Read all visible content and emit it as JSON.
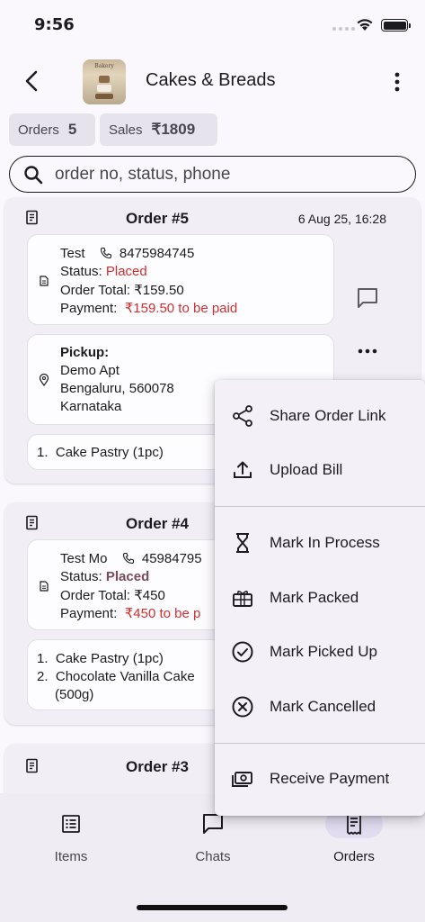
{
  "status_bar": {
    "time": "9:56"
  },
  "appbar": {
    "title": "Cakes & Breads",
    "avatar_text": "Bakery"
  },
  "stats": {
    "orders_label": "Orders",
    "orders_value": "5",
    "sales_label": "Sales",
    "sales_value": "₹1809"
  },
  "search": {
    "placeholder": "order no, status, phone"
  },
  "orders": [
    {
      "title": "Order #5",
      "date": "6 Aug 25, 16:28",
      "customer": "Test",
      "phone": "8475984745",
      "status_label": "Status:",
      "status": "Placed",
      "total_label": "Order Total:",
      "total": "₹159.50",
      "payment_label": "Payment:",
      "payment": "₹159.50 to be paid",
      "pickup_label": "Pickup:",
      "address": [
        "Demo Apt",
        "Bengaluru, 560078",
        "Karnataka"
      ],
      "items": [
        {
          "num": "1.",
          "name": "Cake Pastry (1pc)"
        }
      ]
    },
    {
      "title": "Order #4",
      "customer": "Test Mo",
      "phone": "45984795",
      "status_label": "Status:",
      "status": "Placed",
      "total_label": "Order Total:",
      "total": "₹450",
      "payment_label": "Payment:",
      "payment": "₹450 to be p",
      "items": [
        {
          "num": "1.",
          "name": "Cake Pastry (1pc)"
        },
        {
          "num": "2.",
          "name": "Chocolate Vanilla Cake"
        },
        {
          "num": "",
          "name": "(500g)"
        }
      ]
    },
    {
      "title": "Order #3"
    }
  ],
  "menu": {
    "share": "Share Order Link",
    "upload": "Upload Bill",
    "in_process": "Mark In Process",
    "packed": "Mark Packed",
    "picked_up": "Mark Picked Up",
    "cancelled": "Mark Cancelled",
    "receive_payment": "Receive Payment"
  },
  "nav": {
    "items": "Items",
    "chats": "Chats",
    "orders": "Orders"
  },
  "colors": {
    "accent_red": "#d32f2f",
    "status_maroon": "#7a4a57",
    "selected_pill": "#e2dcf1"
  }
}
